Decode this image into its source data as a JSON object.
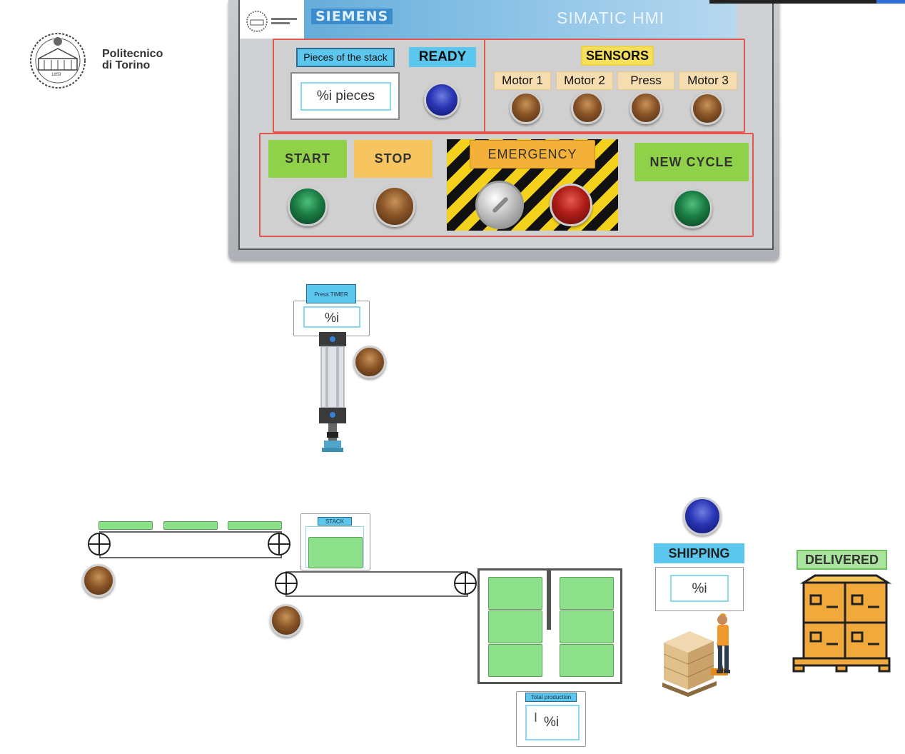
{
  "logo": {
    "line1": "Politecnico",
    "line2": "di Torino",
    "seal_year": "1859"
  },
  "hmi": {
    "brand": "SIEMENS",
    "product": "SIMATIC HMI",
    "header_logo_text": "Politecnico di Torino",
    "stack": {
      "label": "Pieces of the stack",
      "value": "%i pieces"
    },
    "ready": {
      "label": "READY",
      "lamp_color": "#2a36b5"
    },
    "sensors": {
      "title": "SENSORS",
      "items": [
        {
          "label": "Motor 1",
          "lamp_color": "#8a5527"
        },
        {
          "label": "Motor 2",
          "lamp_color": "#8a5527"
        },
        {
          "label": "Press",
          "lamp_color": "#8a5527"
        },
        {
          "label": "Motor 3",
          "lamp_color": "#8a5527"
        }
      ]
    },
    "controls": {
      "start_label": "START",
      "stop_label": "STOP",
      "emergency_label": "EMERGENCY",
      "new_cycle_label": "NEW CYCLE",
      "start_color": "#8fd24a",
      "stop_color": "#f6c560",
      "emergency_color": "#f4b13a",
      "new_cycle_color": "#8fd24a"
    }
  },
  "plant": {
    "press_timer": {
      "label": "Press TIMER",
      "value": "%i"
    },
    "stack_widget": {
      "label": "STACK"
    },
    "total_production": {
      "label": "Total production",
      "value": "%i",
      "cursor": "I"
    },
    "shipping": {
      "label": "SHIPPING",
      "value": "%i"
    },
    "delivered": {
      "label": "DELIVERED"
    }
  },
  "colors": {
    "piece_green": "#8de08a",
    "label_blue": "#5bc7ee",
    "section_border": "#e2574c"
  }
}
